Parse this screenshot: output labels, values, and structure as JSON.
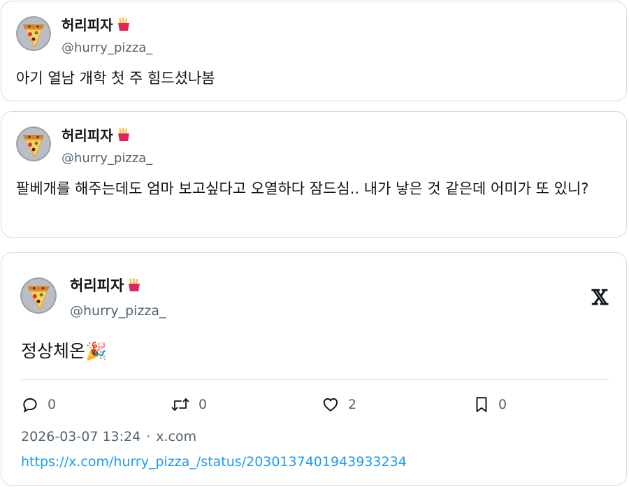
{
  "tweets": [
    {
      "display_name": "허리피자",
      "handle": "@hurry_pizza_",
      "text": "아기 열남 개학 첫 주 힘드셨나봄",
      "avatar_icon": "pizza-avatar-icon",
      "name_emoji": "fries-icon"
    },
    {
      "display_name": "허리피자",
      "handle": "@hurry_pizza_",
      "text": "팔베개를 해주는데도 엄마 보고싶다고 오열하다 잠드심.. 내가 낳은 것 같은데 어미가 또 있니?",
      "avatar_icon": "pizza-avatar-icon",
      "name_emoji": "fries-icon"
    }
  ],
  "embed": {
    "display_name": "허리피자",
    "handle": "@hurry_pizza_",
    "text": "정상체온🎉",
    "x_logo": "𝕏",
    "actions": {
      "reply_count": "0",
      "retweet_count": "0",
      "like_count": "2",
      "bookmark_count": "0"
    },
    "timestamp": "2026-03-07 13:24",
    "separator": "·",
    "source": "x.com",
    "url": "https://x.com/hurry_pizza_/status/2030137401943933234"
  },
  "colors": {
    "text": "#0f1419",
    "secondary": "#536471",
    "link": "#1d9bf0",
    "border": "#d4d9de"
  }
}
